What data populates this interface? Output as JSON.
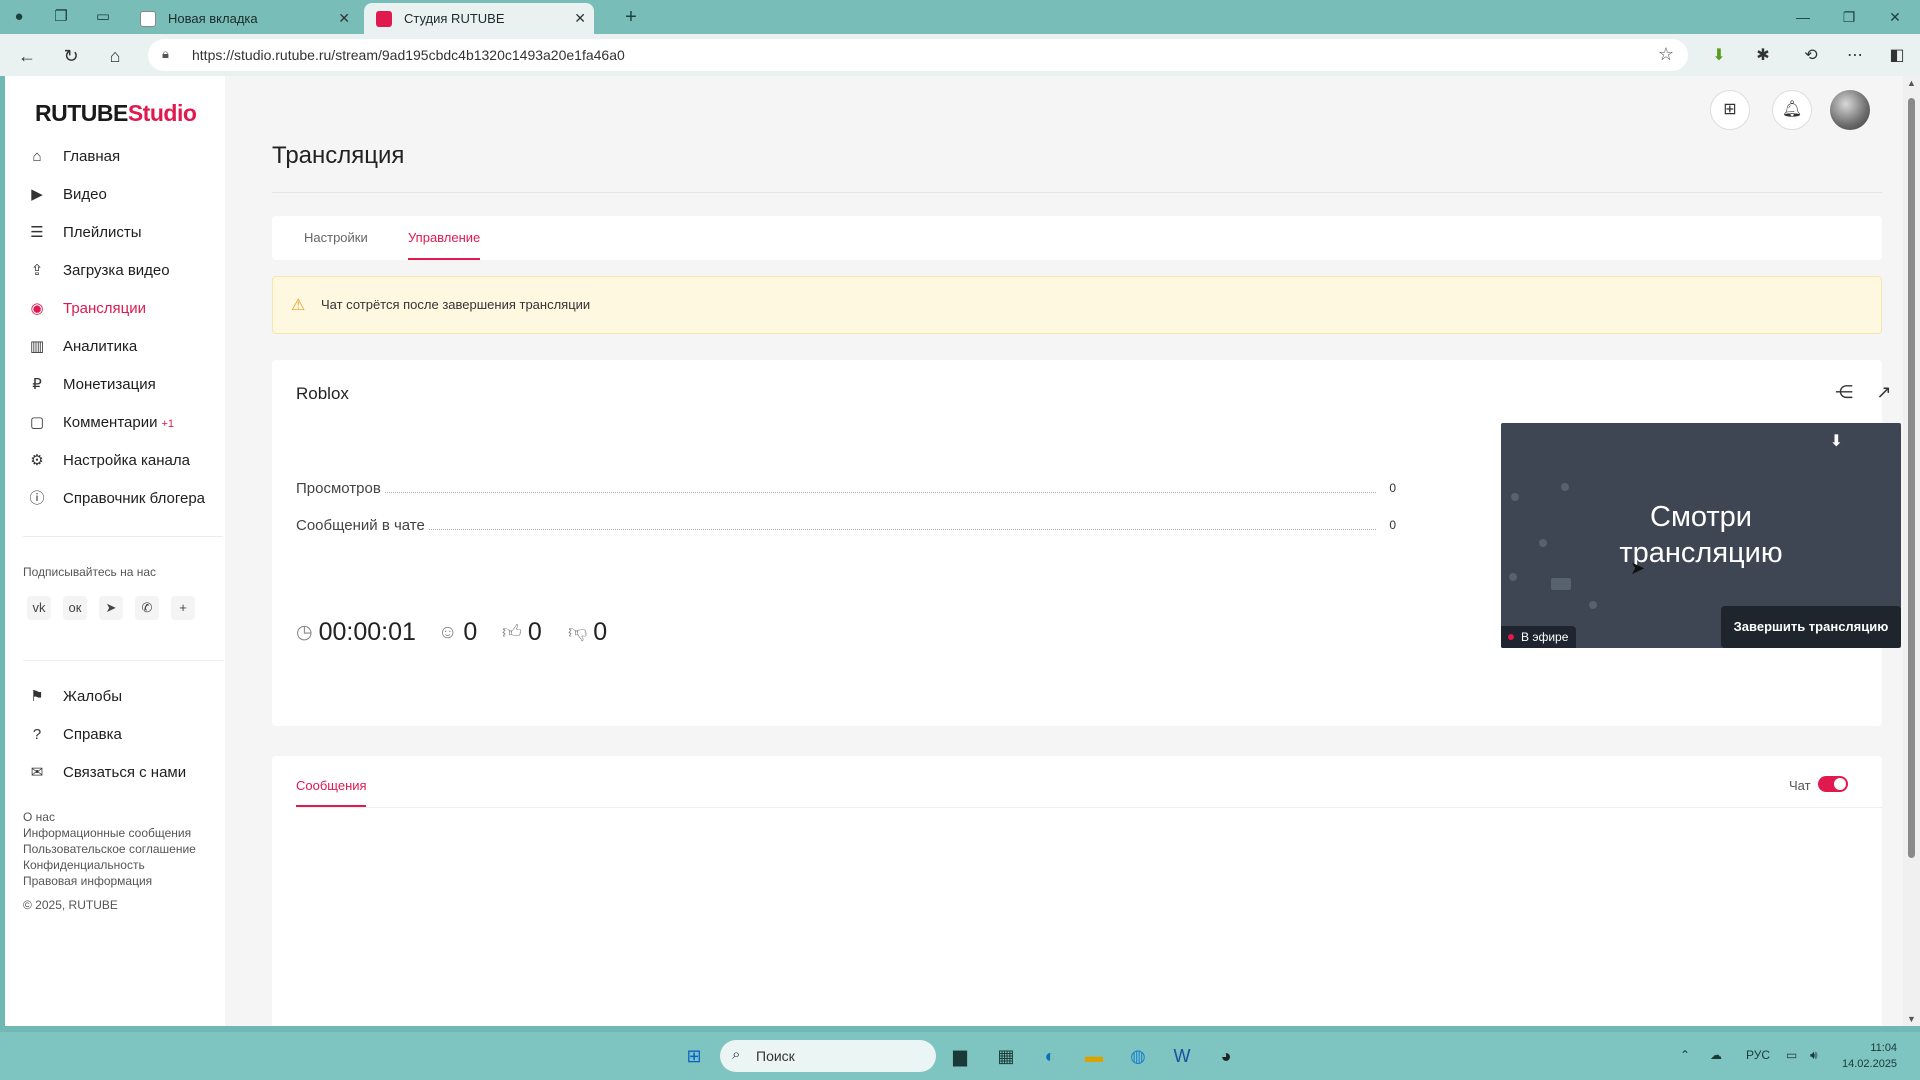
{
  "browser": {
    "tabs": [
      {
        "title": "Новая вкладка"
      },
      {
        "title": "Студия RUTUBE"
      }
    ],
    "url": "https://studio.rutube.ru/stream/9ad195cbdc4b1320c1493a20e1fa46a0"
  },
  "logo": {
    "part1": "RUTUBE",
    "part2": "Studio"
  },
  "sidebar": {
    "items": [
      {
        "label": "Главная",
        "icon": "home-icon"
      },
      {
        "label": "Видео",
        "icon": "video-icon"
      },
      {
        "label": "Плейлисты",
        "icon": "playlist-icon"
      },
      {
        "label": "Загрузка видео",
        "icon": "upload-icon"
      },
      {
        "label": "Трансляции",
        "icon": "broadcast-icon",
        "active": true
      },
      {
        "label": "Аналитика",
        "icon": "analytics-icon"
      },
      {
        "label": "Монетизация",
        "icon": "ruble-icon"
      },
      {
        "label": "Комментарии",
        "icon": "comment-icon",
        "badge": "+1"
      },
      {
        "label": "Настройка канала",
        "icon": "gear-icon"
      },
      {
        "label": "Справочник блогера",
        "icon": "info-icon"
      }
    ],
    "follow_label": "Подписывайтесь на нас",
    "bottom_items": [
      {
        "label": "Жалобы",
        "icon": "flag-icon"
      },
      {
        "label": "Справка",
        "icon": "help-icon"
      },
      {
        "label": "Связаться с нами",
        "icon": "mail-icon"
      }
    ],
    "footer_links": [
      "О нас",
      "Информационные сообщения",
      "Пользовательское соглашение",
      "Конфиденциальность",
      "Правовая информация"
    ],
    "copyright": "© 2025, RUTUBE"
  },
  "main": {
    "title": "Трансляция",
    "tabs": [
      {
        "label": "Настройки"
      },
      {
        "label": "Управление",
        "active": true
      }
    ],
    "alert": "Чат сотрётся после завершения трансляции",
    "stream": {
      "name": "Roblox",
      "stats": [
        {
          "label": "Просмотров",
          "value": "0"
        },
        {
          "label": "Сообщений в чате",
          "value": "0"
        }
      ],
      "preview_text_line1": "Смотри",
      "preview_text_line2": "трансляцию",
      "live_label": "В эфире",
      "duration": "00:00:01",
      "viewers": "0",
      "likes": "0",
      "dislikes": "0",
      "end_button": "Завершить трансляцию"
    },
    "messages": {
      "tab_label": "Сообщения",
      "chat_toggle_label": "Чат",
      "chat_enabled": true
    }
  },
  "taskbar": {
    "search_label": "Поиск",
    "language": "РУС",
    "time": "11:04",
    "date": "14.02.2025"
  },
  "colors": {
    "accent": "#e0194f",
    "dark_button": "#1f252c",
    "alert_bg": "#fff8e0"
  }
}
